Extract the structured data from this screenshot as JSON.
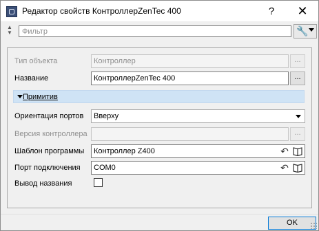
{
  "window": {
    "title": "Редактор свойств КонтроллерZenTec 400",
    "help_label": "?",
    "close_label": "✕"
  },
  "filter": {
    "placeholder": "Фильтр"
  },
  "properties": {
    "object_type": {
      "label": "Тип объекта",
      "value": "Контроллер",
      "button": "..."
    },
    "name": {
      "label": "Название",
      "value": "КонтроллерZenTec 400",
      "button": "..."
    },
    "section_title": "Примитив",
    "port_orientation": {
      "label": "Ориентация портов",
      "value": "Вверху"
    },
    "controller_version": {
      "label": "Версия контроллера",
      "value": "",
      "button": "..."
    },
    "program_template": {
      "label": "Шаблон программы",
      "value": "Контроллер Z400"
    },
    "connection_port": {
      "label": "Порт подключения",
      "value": "COM0"
    },
    "show_name": {
      "label": "Вывод названия",
      "checked": false
    }
  },
  "footer": {
    "ok_label": "OK"
  },
  "colors": {
    "section_bg": "#cfe3f5",
    "accent": "#0078d7"
  }
}
